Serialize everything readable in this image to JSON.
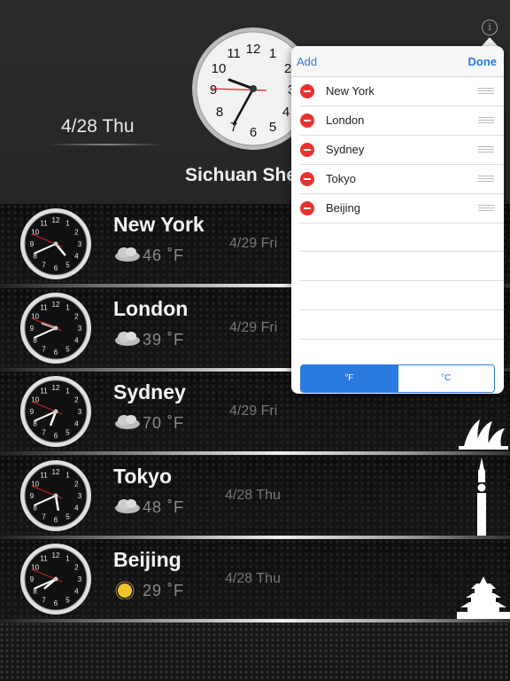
{
  "header": {
    "date": "4/28 Thu",
    "city": "Sichuan Sheng"
  },
  "cities": [
    {
      "name": "New York",
      "temp": "46 ˚F",
      "date": "4/29 Fri",
      "weather": "cloudy-icon",
      "time": "4:41"
    },
    {
      "name": "London",
      "temp": "39 ˚F",
      "date": "4/29 Fri",
      "weather": "cloudy-icon",
      "time": "9:41"
    },
    {
      "name": "Sydney",
      "temp": "70 ˚F",
      "date": "4/29 Fri",
      "weather": "cloudy-icon",
      "time": "6:41"
    },
    {
      "name": "Tokyo",
      "temp": "48 ˚F",
      "date": "4/28 Thu",
      "weather": "cloudy-icon",
      "time": "5:41"
    },
    {
      "name": "Beijing",
      "temp": "29 ˚F",
      "date": "4/28 Thu",
      "weather": "sunny-icon",
      "time": "7:41"
    }
  ],
  "popover": {
    "add": "Add",
    "done": "Done",
    "items": [
      "New York",
      "London",
      "Sydney",
      "Tokyo",
      "Beijing"
    ],
    "unit_f": "°F",
    "unit_c": "°C",
    "selected_unit": "°F"
  },
  "colors": {
    "accent": "#2a7be0",
    "delete": "#e8322e",
    "second_hand": "#d22020"
  }
}
